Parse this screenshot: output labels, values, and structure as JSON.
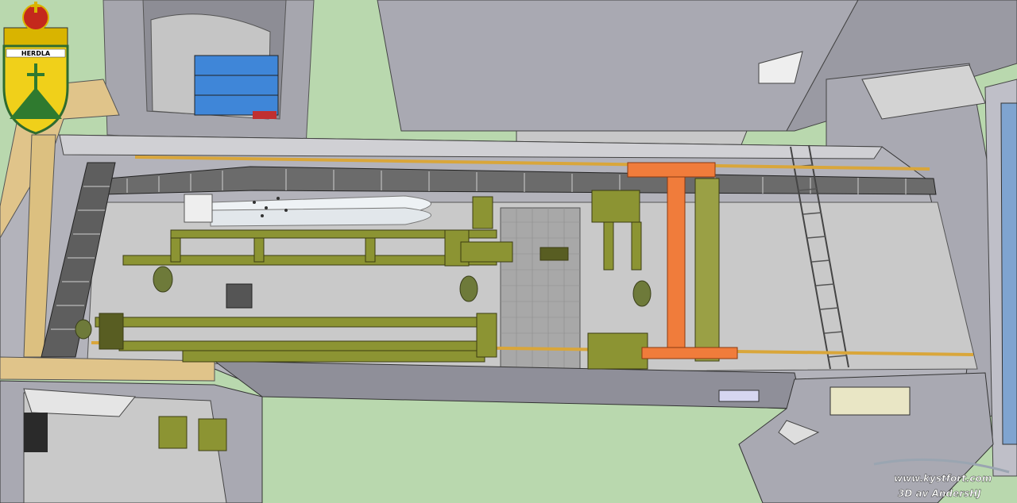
{
  "emblem": {
    "name": "HERDLA"
  },
  "watermark": {
    "site": "www.kystfort.com",
    "credit": "3D av AndersHJ"
  },
  "colors": {
    "grass": "#b9d8ae",
    "wall": "#a9a9b2",
    "floor": "#c9c9c9",
    "beam": "#d9a63a",
    "machinery": "#8c9433",
    "crane": "#f07c3b",
    "torpedo": "#e9eef2",
    "rack": "#3f86d8"
  }
}
